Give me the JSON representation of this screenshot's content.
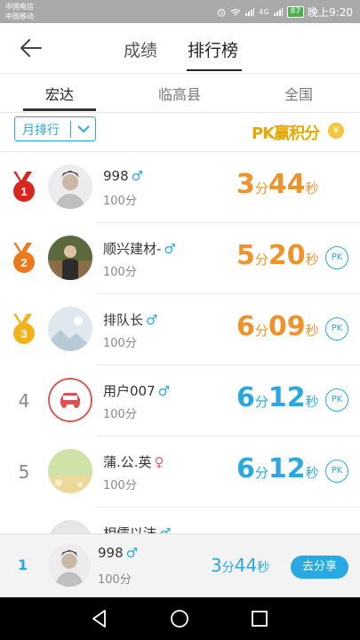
{
  "status_bar": {
    "carrier1": "中国电信",
    "carrier2": "中国移动",
    "signal": "4G",
    "battery": "87",
    "clock": "晚上9:20"
  },
  "header": {
    "tabs": [
      {
        "label": "成绩",
        "active": false
      },
      {
        "label": "排行榜",
        "active": true
      }
    ]
  },
  "subtabs": [
    {
      "label": "宏达",
      "active": true
    },
    {
      "label": "临高县",
      "active": false
    },
    {
      "label": "全国",
      "active": false
    }
  ],
  "filter": {
    "label": "月排行"
  },
  "pk_banner": {
    "text": "PK赢积分",
    "coin_symbol": "¥"
  },
  "time_units": {
    "minute": "分",
    "second": "秒"
  },
  "ranking": [
    {
      "rank": "1",
      "medal": "gold-red",
      "name": "998",
      "gender": "♂",
      "gender_type": "male",
      "score": "100分",
      "minutes": "3",
      "seconds": "44",
      "color": "orange",
      "pk": ""
    },
    {
      "rank": "2",
      "medal": "orange",
      "name": "顺兴建材-",
      "gender": "♂",
      "gender_type": "male",
      "score": "100分",
      "minutes": "5",
      "seconds": "20",
      "color": "orange",
      "pk": "PK"
    },
    {
      "rank": "3",
      "medal": "gold",
      "name": "排​队长",
      "gender": "♂",
      "gender_type": "male",
      "score": "100分",
      "minutes": "6",
      "seconds": "09",
      "color": "orange",
      "pk": "PK"
    },
    {
      "rank": "4",
      "medal": "",
      "name": "用户007",
      "gender": "♂",
      "gender_type": "male",
      "score": "100分",
      "minutes": "6",
      "seconds": "12",
      "color": "blue",
      "pk": "PK"
    },
    {
      "rank": "5",
      "medal": "",
      "name": "蒲.公.英",
      "gender": "♀",
      "gender_type": "female",
      "score": "100分",
      "minutes": "6",
      "seconds": "12",
      "color": "blue",
      "pk": "PK"
    },
    {
      "rank": "",
      "medal": "",
      "name": "相儒以沫",
      "gender": "♂",
      "gender_type": "male",
      "score": "",
      "minutes": "",
      "seconds": "",
      "color": "blue",
      "pk": ""
    }
  ],
  "my_rank": {
    "rank": "1",
    "name": "998",
    "gender": "♂",
    "score": "100分",
    "minutes": "3",
    "seconds": "44",
    "share_label": "去分享"
  },
  "colors": {
    "accent_blue": "#29a9e0",
    "orange": "#f0922b",
    "medal_red": "#d7261e",
    "medal_orange": "#ec7a1c",
    "medal_gold": "#f1b31c"
  },
  "icons": {
    "back": "arrow-left-icon",
    "filter": "chevron-down-icon",
    "nav": [
      "back-triangle-icon",
      "home-circle-icon",
      "recents-square-icon"
    ]
  }
}
